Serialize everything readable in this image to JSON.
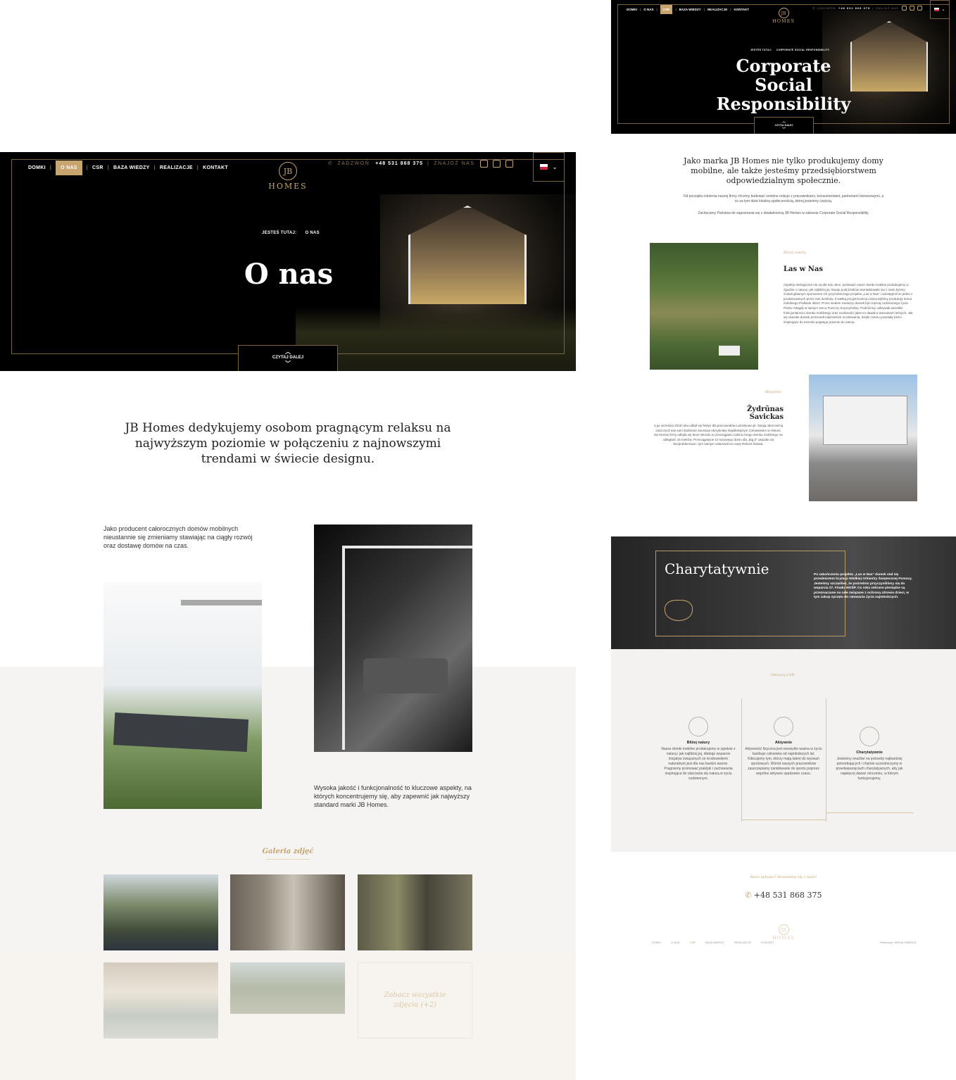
{
  "nav": {
    "items": [
      "DOMKI",
      "O NAS",
      "CSR",
      "BAZA WIEDZY",
      "REALIZACJE",
      "KONTAKT"
    ]
  },
  "logo": {
    "mark": "JB",
    "name": "HOMES"
  },
  "contact": {
    "call_label": "ZADZWOŃ",
    "phone": "+48 531 868 375",
    "find_label": "ZNAJDŹ NAS"
  },
  "left": {
    "breadcrumb_label": "JESTEŚ TUTAJ:",
    "breadcrumb_current": "O NAS",
    "hero_title": "O nas",
    "read_more": "CZYTAJ DALEJ",
    "lead": "JB Homes dedykujemy osobom pragnącym relaksu na najwyższym poziomie w połączeniu z najnowszymi trendami w świecie designu.",
    "para1": "Jako producent całorocznych domów mobilnych nieustannie się zmieniamy stawiając na ciągły rozwój oraz dostawę domów na czas.",
    "para2": "Wysoka jakość i funkcjonalność to kluczowe aspekty, na których koncentrujemy się, aby zapewnić jak najwyższy standard marki JB Homes.",
    "gallery_title": "Galeria zdjęć",
    "gallery_more": "Zobacz wszystkie zdjęcia (+2)"
  },
  "right": {
    "breadcrumb_label": "JESTEŚ TUTAJ:",
    "breadcrumb_current": "CORPORATE SOCIAL RESPONSIBILITY",
    "hero_title": "Corporate Social Responsibility",
    "read_more": "CZYTAJ DALEJ",
    "lead": "Jako marka JB Homes nie tylko produkujemy domy mobilne, ale także jesteśmy przedsiębiorstwem odpowiedzialnym społecznie.",
    "intro1": "Od początku istnienia naszej firmy chcemy budować rzetelne relacje z pracownikami, konsumentami, partnerami biznesowymi, a co za tym idzie lokalną społecznością, której jesteśmy częścią.",
    "intro2": "Zachęcamy Państwa do zapoznania się z działalnością JB Homes w zakresie Corporate Social Responsibility.",
    "sec1_label": "Bliżej natury",
    "sec1_title": "Las w Nas",
    "sec1_text": "Aspekty ekologiczne nie są dla nas obce, ponieważ nasze domki mobilne produkujemy w zgodzie z naturą i jak najbliżej jej. Dwoje podróżników skontaktowało się z nami byśmy zostali głównym sponsorem ich przyrodniczego projektu „Las w Nas” i udostępnili im jeden z produkowanych przez nas domków. Z wielką przyjemnością rozpoczęliśmy produkcję domu mobilnego Podlasie 35m2. Przez siedem miesięcy domek był częścią codziennego życia Piotra i Magdy w samym sercu Puszczy Knyszyńskiej. Podróżnicy odkrywali wszelkie funkcjonalności domku mobilnego oraz możliwości jakie im dawał w warunkach leśnych. Jak się okazało domek przeszedł najśmielsze oczekiwania, dzięki czemu powstały treści inspirujące do szeroko pojętego powrotu do natury.",
    "sec2_label": "Aktywnie",
    "sec2_title": "Žydrūnas Savickas",
    "sec2_text": "1-go września 2018 roku odbył się festyn dla pracowników Letniskowo.pl. Swoją obecnością zaszczycił nas sam Žydrūnas Savickas okrzyknięty Najsilniejszym Człowiekiem w Historii. Na terenie firmy odbyła się bicie rekordu w przeciąganiu całorocznego domku mobilnego na odległość 15 metrów. Przeciągnięcie 10 tonowego domu dla „Big Z” okazało się bezproblemowe i tym samym ustanowił on nowy Rekord Świata.",
    "charity_title": "Charytatywnie",
    "charity_text": "Po zakończeniu projektu „Las w Nas” domek stał się przedmiotem licytacji Wielkiej Orkiestry Świątecznej Pomocy. Jesteśmy szczęśliwi, że pośrednio przyczyniliśmy się do wsparcia 27. Finału WOŚP. Co roku zebrane pieniądze są przeznaczane na cele związane z ochroną zdrowia dzieci, w tym zakup sprzętu do ratowania życia najmłodszych.",
    "values_label": "Obszary CSR",
    "values": [
      {
        "title": "Bliżej natury",
        "text": "Nasze domki mobilne produkujemy w zgodzie z naturą i jak najbliżej jej, dlatego wsparcie inicjatyw związanych ze środowiskiem naturalnym jest dla nas bardzo ważne. Pragniemy promować praktyki i zachowania inspirujące do otaczania się naturą w życiu codziennym.",
        "icon": "leaf-icon"
      },
      {
        "title": "Aktywnie",
        "text": "Aktywność fizyczna jest niezwykle ważna w życiu każdego człowieka od najmłodszych lat. Kibicujemy tym, którzy mają talent do wyzwań sportowych. Wśród naszych pracowników zaszczepiamy zamiłowanie do sportu poprzez wspólne aktywne spędzanie czasu.",
        "icon": "trees-icon"
      },
      {
        "title": "Charytatywnie",
        "text": "Jesteśmy wrażliwi na potrzeby najbardziej potrzebujących i chętnie uczestniczymy w przedsięwzięciach charytatywnych, aby jak najwięcej dawać otoczeniu, w którym funkcjonujemy.",
        "icon": "people-icon"
      }
    ],
    "footer_question": "Masz pytania? Skontaktuj się z nami!",
    "footer_phone": "+48 531 868 375",
    "footer_credit": "Realizacja: MEDIA FABRICA"
  },
  "colors": {
    "gold": "#c8a46e",
    "dark": "#000000",
    "light_bg": "#f5f4f2"
  }
}
